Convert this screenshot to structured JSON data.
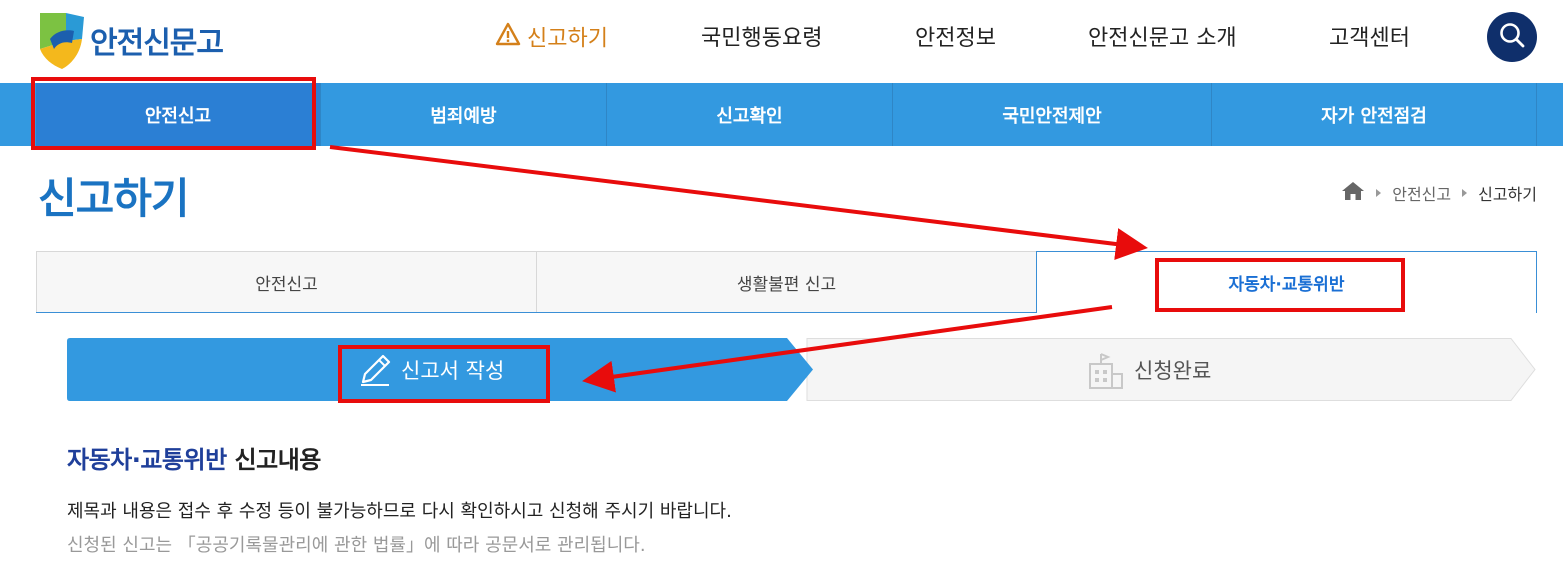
{
  "header": {
    "logo_text": "안전신문고",
    "gnb": [
      {
        "label": "신고하기",
        "active": true
      },
      {
        "label": "국민행동요령",
        "active": false
      },
      {
        "label": "안전정보",
        "active": false
      },
      {
        "label": "안전신문고 소개",
        "active": false
      },
      {
        "label": "고객센터",
        "active": false
      }
    ],
    "search_icon": "search-icon"
  },
  "subnav": [
    {
      "label": "안전신고",
      "active": true
    },
    {
      "label": "범죄예방",
      "active": false
    },
    {
      "label": "신고확인",
      "active": false
    },
    {
      "label": "국민안전제안",
      "active": false
    },
    {
      "label": "자가 안전점검",
      "active": false
    }
  ],
  "page": {
    "title": "신고하기",
    "breadcrumb": [
      "안전신고",
      "신고하기"
    ]
  },
  "tabs": [
    {
      "label": "안전신고",
      "active": false
    },
    {
      "label": "생활불편 신고",
      "active": false
    },
    {
      "label": "자동차·교통위반",
      "active": true
    }
  ],
  "steps": [
    {
      "label": "신고서 작성",
      "icon": "pencil-icon",
      "active": true
    },
    {
      "label": "신청완료",
      "icon": "building-icon",
      "active": false
    }
  ],
  "content": {
    "title_highlight": "자동차·교통위반",
    "title_rest": " 신고내용",
    "notice_primary": "제목과 내용은 접수 후 수정 등이 불가능하므로 다시 확인하시고 신청해 주시기 바랍니다.",
    "notice_secondary": "신청된 신고는 「공공기록물관리에 관한 법률」에 따라 공문서로 관리됩니다."
  },
  "colors": {
    "brand_blue": "#3399e0",
    "title_blue": "#1a73c2",
    "active_orange": "#d4801a",
    "annotation_red": "#e80c0c"
  }
}
